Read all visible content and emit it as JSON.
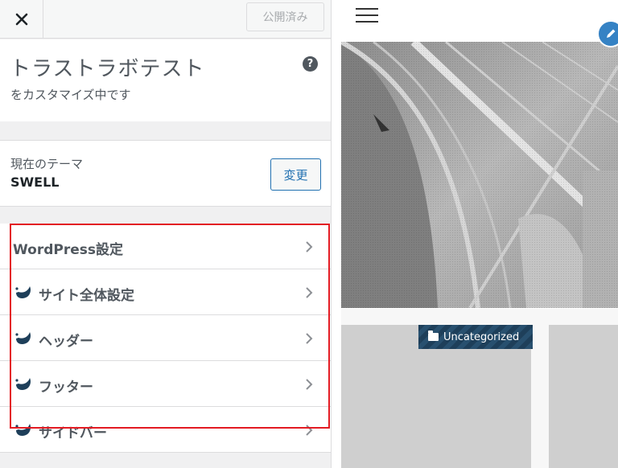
{
  "topbar": {
    "close_icon": "close-icon",
    "publish_label": "公開済み"
  },
  "info": {
    "site_title": "トラストラボテスト",
    "subtitle": "をカスタマイズ中です",
    "help_icon": "help-icon",
    "help_glyph": "?"
  },
  "theme": {
    "label": "現在のテーマ",
    "name": "SWELL",
    "change_label": "変更"
  },
  "menu": {
    "items": [
      {
        "label": "WordPress設定",
        "icon": null
      },
      {
        "label": "サイト全体設定",
        "icon": "swell-logo-icon"
      },
      {
        "label": "ヘッダー",
        "icon": "swell-logo-icon"
      },
      {
        "label": "フッター",
        "icon": "swell-logo-icon"
      },
      {
        "label": "サイドバー",
        "icon": "swell-logo-icon"
      }
    ],
    "chevron_icon": "chevron-right-icon"
  },
  "highlight": {
    "color": "#e31b23"
  },
  "preview": {
    "menu_icon": "hamburger-menu-icon",
    "edit_icon": "pencil-icon",
    "category_badge": "Uncategorized",
    "category_icon": "folder-icon"
  },
  "colors": {
    "accent": "#2271b1",
    "badge_bg": "#1e3f5a",
    "edit_button": "#3582c4"
  }
}
